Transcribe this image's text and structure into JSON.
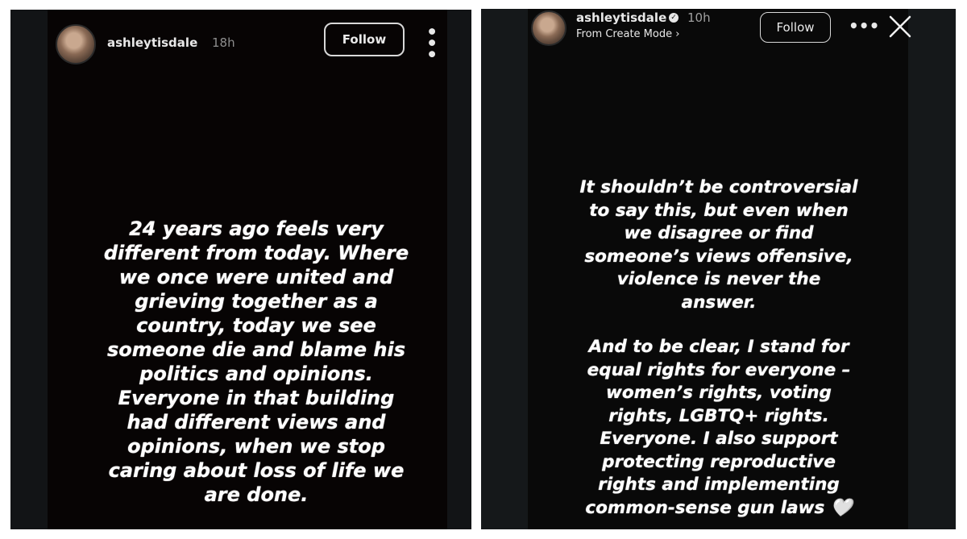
{
  "left_story": {
    "username": "ashleytisdale",
    "time": "18h",
    "follow_label": "Follow",
    "more_label": "•••",
    "text": "24 years ago feels very\ndifferent from today. Where\nwe once were united and\ngrieving together as a\ncountry, today we see\nsomeone die and blame his\npolitics and opinions.\nEveryone in that building\nhad different views and\nopinions, when we stop\ncaring about loss of life we\nare done."
  },
  "right_story": {
    "username": "ashleytisdale",
    "verified_icon": "verified-badge",
    "verified_glyph": "✓",
    "time": "10h",
    "subline": "From Create Mode ›",
    "follow_label": "Follow",
    "more_label": "•••",
    "close_icon": "close-icon",
    "paragraph1": "It shouldn’t be controversial\nto say this, but even when\nwe disagree or find\nsomeone’s views offensive,\nviolence is never the\nanswer.",
    "paragraph2": "And to be clear, I stand for\nequal rights for everyone –\nwomen’s rights, voting\nrights, LGBTQ+ rights.\nEveryone. I also support\nprotecting reproductive\nrights and implementing\ncommon-sense gun laws 🤍"
  },
  "colors": {
    "background": "#121416",
    "story_background": "#070404",
    "text": "#ffffff",
    "muted": "#8e8e8e"
  }
}
